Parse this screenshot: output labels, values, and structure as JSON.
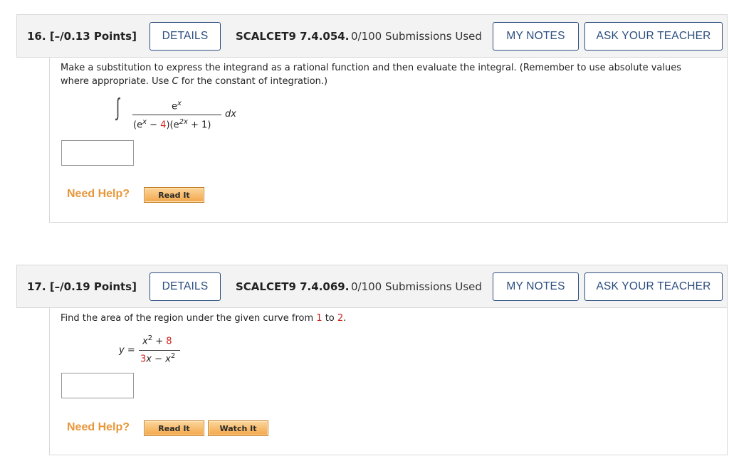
{
  "questions": [
    {
      "number": "16.",
      "points": "[–/0.13 Points]",
      "details_label": "DETAILS",
      "code": "SCALCET9 7.4.054.",
      "submissions": "0/100 Submissions Used",
      "my_notes_label": "MY NOTES",
      "ask_teacher_label": "ASK YOUR TEACHER",
      "prompt_line1": "Make a substitution to express the integrand as a rational function and then evaluate the integral. (Remember to use absolute values",
      "prompt_line2_a": "where appropriate. Use ",
      "prompt_line2_c": "C",
      "prompt_line2_b": " for the constant of integration.)",
      "math": {
        "integral_sign": "∫",
        "numerator": "e",
        "numerator_sup": "x",
        "den_open": "(e",
        "den_sup1": "x",
        "den_minus": " − ",
        "den_const": "4",
        "den_mid": ")(e",
        "den_sup2": "2x",
        "den_end": " + 1)",
        "dx": "dx"
      },
      "answer_value": "",
      "need_help": "Need Help?",
      "help_buttons": [
        "Read It"
      ]
    },
    {
      "number": "17.",
      "points": "[–/0.19 Points]",
      "details_label": "DETAILS",
      "code": "SCALCET9 7.4.069.",
      "submissions": "0/100 Submissions Used",
      "my_notes_label": "MY NOTES",
      "ask_teacher_label": "ASK YOUR TEACHER",
      "prompt_a": "Find the area of the region under the given curve from ",
      "prompt_from": "1",
      "prompt_to_word": " to ",
      "prompt_to": "2",
      "prompt_end": ".",
      "math": {
        "lhs": "y =",
        "num_x": "x",
        "num_sup": "2",
        "num_plus": " + ",
        "num_const": "8",
        "den_coef": "3",
        "den_x": "x",
        "den_minus": " − ",
        "den_x2": "x",
        "den_sup": "2"
      },
      "answer_value": "",
      "need_help": "Need Help?",
      "help_buttons": [
        "Read It",
        "Watch It"
      ]
    }
  ],
  "colors": {
    "button_border": "#2c4d7f",
    "need_help": "#e8963a",
    "highlight_red": "#d1231c",
    "header_bg": "#f3f3f3"
  }
}
